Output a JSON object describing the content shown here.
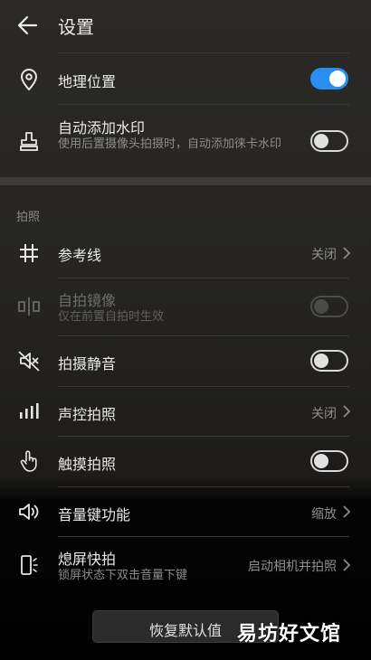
{
  "header": {
    "title": "设置"
  },
  "general": {
    "location": {
      "label": "地理位置",
      "toggle": "on"
    },
    "watermark": {
      "label": "自动添加水印",
      "sub": "使用后置摄像头拍摄时，自动添加徕卡水印",
      "toggle": "off"
    }
  },
  "section_title": "拍照",
  "photo": {
    "gridlines": {
      "label": "参考线",
      "value": "关闭"
    },
    "mirror": {
      "label": "自拍镜像",
      "sub": "仅在前置自拍时生效",
      "toggle": "disabled"
    },
    "mute": {
      "label": "拍摄静音",
      "toggle": "off"
    },
    "voice": {
      "label": "声控拍照",
      "value": "关闭"
    },
    "touch": {
      "label": "触摸拍照",
      "toggle": "off"
    },
    "volume_key": {
      "label": "音量键功能",
      "value": "缩放"
    },
    "quick_snap": {
      "label": "熄屏快拍",
      "sub": "锁屏状态下双击音量下键",
      "value": "启动相机并拍照"
    }
  },
  "footer": {
    "restore_label": "恢复默认值"
  },
  "watermark_text": "易坊好文馆",
  "colors": {
    "toggle_on": "#2a8df0",
    "background": "#262522",
    "text": "#eaeaea",
    "secondary_text": "#8e8e8e"
  },
  "icons": {
    "back": "arrow-left-icon",
    "location": "location-pin-icon",
    "watermark": "stamp-icon",
    "gridlines": "grid-hash-icon",
    "mirror": "mirror-icon",
    "mute": "speaker-muted-icon",
    "voice": "signal-bars-icon",
    "touch": "hand-pointer-icon",
    "volume_key": "speaker-icon",
    "quick_snap": "phone-vibrate-icon"
  }
}
